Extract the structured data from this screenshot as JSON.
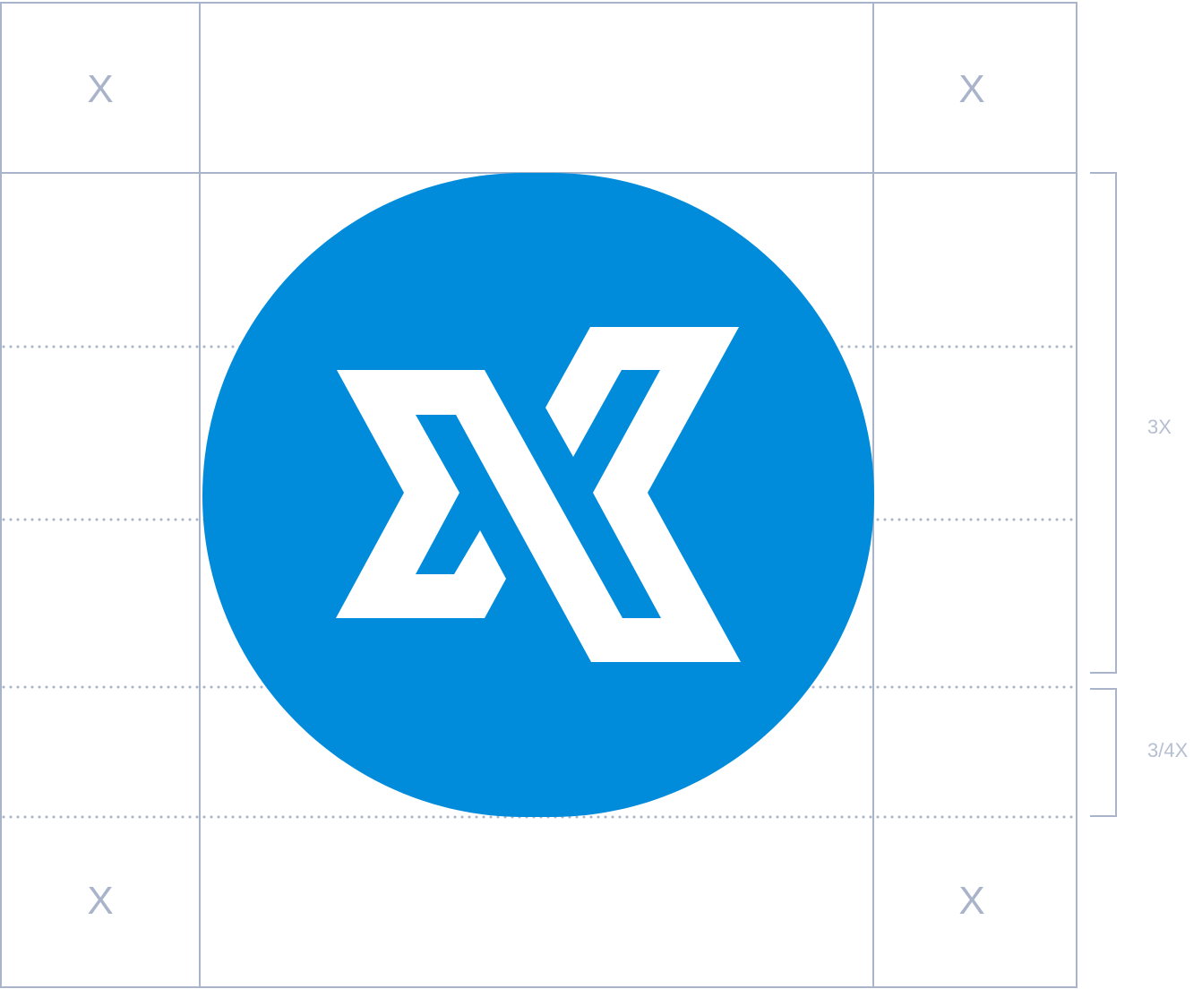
{
  "corner_labels": [
    "X",
    "X",
    "X",
    "X"
  ],
  "dimensions": {
    "height_label": "3X",
    "bottom_margin_label": "3/4X"
  },
  "colors": {
    "logo_blue": "#008bdb",
    "logo_mark": "#ffffff",
    "guide_lines": "#a9b3c9",
    "label_text": "#b6bfd2"
  },
  "icons": {
    "logo": "double-chevron-x-mark-in-blue-circle"
  }
}
